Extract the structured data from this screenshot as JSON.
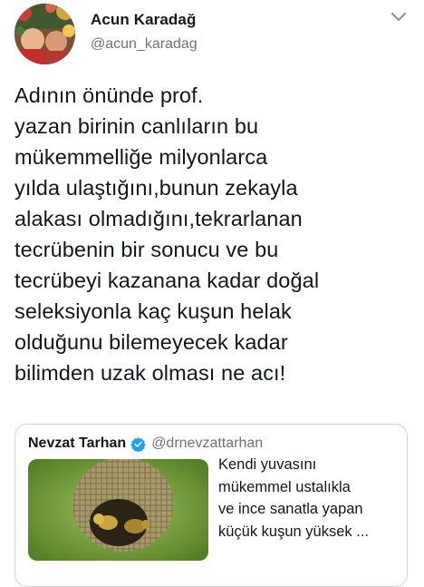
{
  "tweet": {
    "author": {
      "display_name": "Acun Karadağ",
      "handle": "@acun_karadag",
      "avatar_icon": "profile-photo"
    },
    "menu_icon": "chevron-down-icon",
    "text": "Adının önünde prof.\nyazan birinin canlıların bu\nmükemmelliğe milyonlarca\nyılda ulaştığını,bunun zekayla\nalakası olmadığını,tekrarlanan\ntecrübenin bir sonucu ve bu\ntecrübeyi kazanana kadar doğal\nseleksiyonla kaç kuşun helak\nolduğunu bilemeyecek kadar\nbilimden uzak olması ne acı!"
  },
  "quoted_tweet": {
    "author": {
      "display_name": "Nevzat Tarhan",
      "handle": "@drnevzattarhan",
      "verified_icon": "verified-badge-icon",
      "verified_color": "#1da1f2"
    },
    "text": "Kendi yuvasını\nmükemmel ustalıkla\nve ince sanatla yapan\nküçük kuşun yüksek ...",
    "image": "bird-in-woven-nest"
  },
  "colors": {
    "primary_text": "#14171a",
    "secondary_text": "#657786",
    "border": "#ccd6dd",
    "accent": "#1da1f2"
  }
}
